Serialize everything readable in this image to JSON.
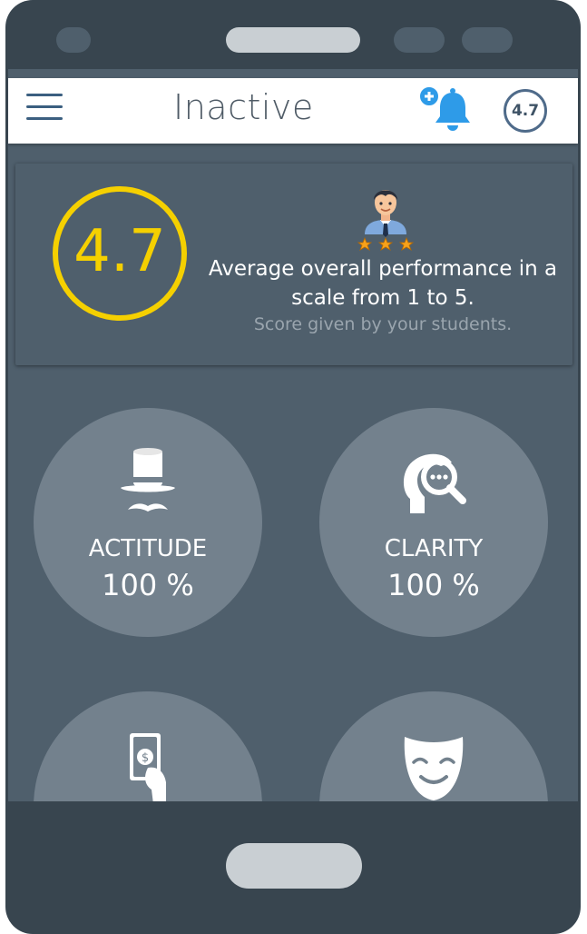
{
  "header": {
    "title": "Inactive",
    "score_badge": "4.7",
    "menu_icon": "hamburger-menu-icon",
    "notification_icon": "bell-plus-icon"
  },
  "summary": {
    "score": "4.7",
    "description": "Average overall performance in a scale from 1 to 5.",
    "subtitle": "Score given by your students.",
    "icon": "teacher-rating-icon"
  },
  "metrics": [
    {
      "label": "ACTITUDE",
      "value": "100 %",
      "icon": "top-hat-mustache-icon"
    },
    {
      "label": "CLARITY",
      "value": "100 %",
      "icon": "head-magnifier-icon"
    },
    {
      "label": "",
      "value": "",
      "icon": "hand-money-icon"
    },
    {
      "label": "",
      "value": "",
      "icon": "smiling-mask-icon"
    }
  ],
  "colors": {
    "accent": "#f5d000",
    "screen_bg": "#4f5f6c",
    "metric_circle": "#73818d",
    "phone_frame": "#38454f",
    "menu_blue": "#3b5f80",
    "bell_blue": "#2e9be8"
  }
}
